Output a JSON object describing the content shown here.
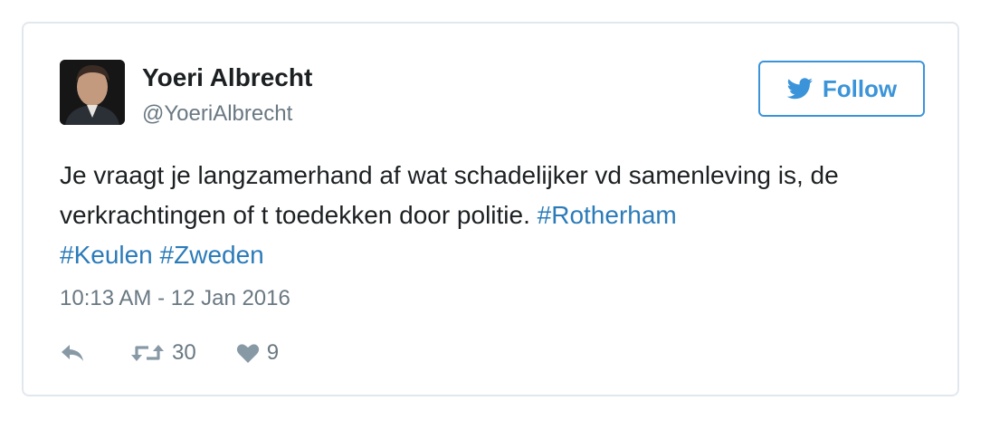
{
  "tweet": {
    "author": {
      "display_name": "Yoeri Albrecht",
      "screen_name": "@YoeriAlbrecht"
    },
    "follow_label": "Follow",
    "text_line1": "Je vraagt je langzamerhand af wat schadelijker vd samenleving is, de verkrachtingen of t toedekken door politie. ",
    "hashtags": [
      "#Rotherham",
      "#Keulen",
      "#Zweden"
    ],
    "timestamp": "10:13 AM - 12 Jan 2016",
    "retweet_count": "30",
    "like_count": "9"
  },
  "colors": {
    "accent": "#3b94d9",
    "hashtag": "#2b7bb9",
    "text": "#1c2022",
    "muted": "#697882",
    "icon": "#8899a6",
    "border": "#e1e8ed"
  },
  "icons": {
    "bird": "twitter-bird-icon",
    "reply": "reply-icon",
    "retweet": "retweet-icon",
    "like": "heart-icon"
  }
}
